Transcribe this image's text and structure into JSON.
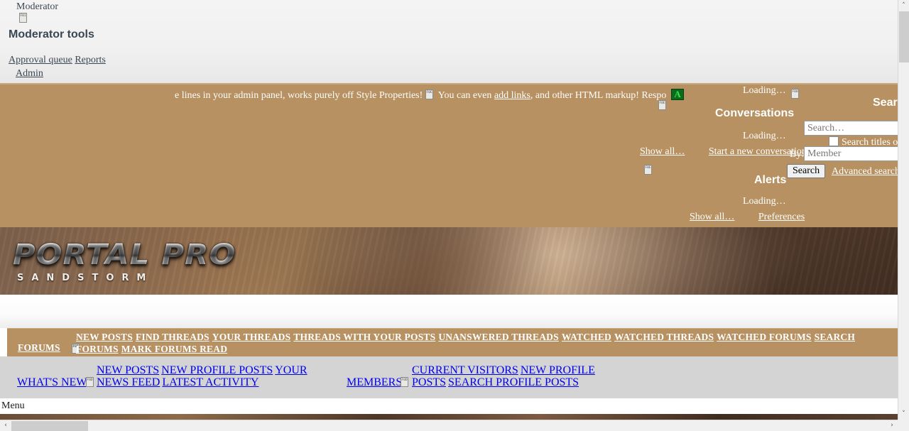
{
  "moderator": {
    "label": "Moderator",
    "tools_title": "Moderator tools",
    "approval_queue": "Approval queue",
    "reports": "Reports",
    "admin": "Admin"
  },
  "notice": {
    "text_before": "e lines in your admin panel, works purely off Style Properties!",
    "text_mid": "You can even",
    "link": "add links",
    "text_after": ", and other HTML markup! Respo",
    "badge": "A",
    "glyph_1": "F0E0",
    "glyph_2": "F0E0"
  },
  "conversations": {
    "loading_top": "Loading…",
    "loading_glyph": "F002",
    "title": "Conversations",
    "loading": "Loading…",
    "show_all": "Show all…",
    "start_new": "Start a new conversation"
  },
  "alerts": {
    "glyph": "F0E1",
    "title": "Alerts",
    "loading": "Loading…",
    "show_all": "Show all…",
    "preferences": "Preferences"
  },
  "search": {
    "title": "Search",
    "placeholder": "Search…",
    "value": "",
    "titles_only": "Search titles only",
    "by_label": "By:",
    "by_placeholder": "Member",
    "by_value": "",
    "button": "Search",
    "advanced": "Advanced search…"
  },
  "logo": {
    "main": "PORTAL PRO",
    "sub": "SANDSTORM"
  },
  "home": {
    "glyph": "F015"
  },
  "nav_forums": {
    "label": "FORUMS",
    "glyph": "F0D7",
    "links": [
      "NEW POSTS",
      "FIND THREADS",
      "YOUR THREADS",
      "THREADS WITH YOUR POSTS",
      "UNANSWERED THREADS",
      "WATCHED",
      "WATCHED THREADS",
      "WATCHED FORUMS",
      "SEARCH FORUMS",
      "MARK FORUMS READ"
    ]
  },
  "nav_whats_new": {
    "label": "WHAT'S NEW",
    "glyph": "F0D7",
    "links": [
      "NEW POSTS",
      "NEW PROFILE POSTS",
      "YOUR NEWS FEED",
      "LATEST ACTIVITY"
    ]
  },
  "nav_members": {
    "label": "MEMBERS",
    "glyph": "F0D7",
    "links": [
      "CURRENT VISITORS",
      "NEW PROFILE POSTS",
      "SEARCH PROFILE POSTS"
    ]
  },
  "menu": {
    "label": "Menu"
  },
  "scrollbars": {
    "up": "˄",
    "down": "˅",
    "left": "‹",
    "right": "›"
  },
  "colors": {
    "tan": "#B79161",
    "tan_border": "#C8A878",
    "nav_gray": "#D4D4D4",
    "nav_text": "#1C2B44",
    "badge_green_bg": "#0A6B1C",
    "badge_green_fg": "#36E04F",
    "top_gray": "#F1F1F1"
  }
}
